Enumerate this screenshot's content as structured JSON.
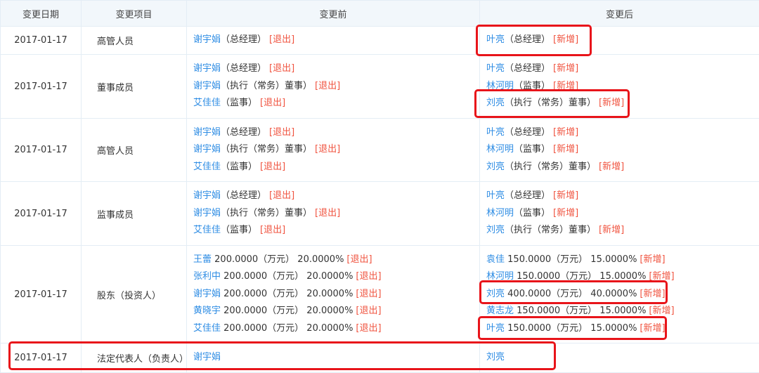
{
  "header": {
    "date": "变更日期",
    "item": "变更项目",
    "before": "变更前",
    "after": "变更后"
  },
  "rows": [
    {
      "date": "2017-01-17",
      "item": "高管人员",
      "before": [
        {
          "name": "谢宇娟",
          "detail": "（总经理）",
          "tag": "[退出]"
        }
      ],
      "after": [
        {
          "name": "叶亮",
          "detail": "（总经理）",
          "tag": "[新增]"
        }
      ]
    },
    {
      "date": "2017-01-17",
      "item": "董事成员",
      "before": [
        {
          "name": "谢宇娟",
          "detail": "（总经理）",
          "tag": "[退出]"
        },
        {
          "name": "谢宇娟",
          "detail": "（执行（常务）董事）",
          "tag": "[退出]"
        },
        {
          "name": "艾佳佳",
          "detail": "（监事）",
          "tag": "[退出]"
        }
      ],
      "after": [
        {
          "name": "叶亮",
          "detail": "（总经理）",
          "tag": "[新增]"
        },
        {
          "name": "林河明",
          "detail": "（监事）",
          "tag": "[新增]"
        },
        {
          "name": "刘亮",
          "detail": "（执行（常务）董事）",
          "tag": "[新增]"
        }
      ]
    },
    {
      "date": "2017-01-17",
      "item": "高管人员",
      "before": [
        {
          "name": "谢宇娟",
          "detail": "（总经理）",
          "tag": "[退出]"
        },
        {
          "name": "谢宇娟",
          "detail": "（执行（常务）董事）",
          "tag": "[退出]"
        },
        {
          "name": "艾佳佳",
          "detail": "（监事）",
          "tag": "[退出]"
        }
      ],
      "after": [
        {
          "name": "叶亮",
          "detail": "（总经理）",
          "tag": "[新增]"
        },
        {
          "name": "林河明",
          "detail": "（监事）",
          "tag": "[新增]"
        },
        {
          "name": "刘亮",
          "detail": "（执行（常务）董事）",
          "tag": "[新增]"
        }
      ]
    },
    {
      "date": "2017-01-17",
      "item": "监事成员",
      "before": [
        {
          "name": "谢宇娟",
          "detail": "（总经理）",
          "tag": "[退出]"
        },
        {
          "name": "谢宇娟",
          "detail": "（执行（常务）董事）",
          "tag": "[退出]"
        },
        {
          "name": "艾佳佳",
          "detail": "（监事）",
          "tag": "[退出]"
        }
      ],
      "after": [
        {
          "name": "叶亮",
          "detail": "（总经理）",
          "tag": "[新增]"
        },
        {
          "name": "林河明",
          "detail": "（监事）",
          "tag": "[新增]"
        },
        {
          "name": "刘亮",
          "detail": "（执行（常务）董事）",
          "tag": "[新增]"
        }
      ]
    },
    {
      "date": "2017-01-17",
      "item": "股东（投资人）",
      "before": [
        {
          "name": "王蕾",
          "detail": " 200.0000（万元） 20.0000%",
          "tag": "[退出]"
        },
        {
          "name": "张利中",
          "detail": " 200.0000（万元） 20.0000%",
          "tag": "[退出]"
        },
        {
          "name": "谢宇娟",
          "detail": " 200.0000（万元） 20.0000%",
          "tag": "[退出]"
        },
        {
          "name": "黄晓宇",
          "detail": " 200.0000（万元） 20.0000%",
          "tag": "[退出]"
        },
        {
          "name": "艾佳佳",
          "detail": " 200.0000（万元） 20.0000%",
          "tag": "[退出]"
        }
      ],
      "after": [
        {
          "name": "袁佳",
          "detail": " 150.0000（万元） 15.0000%",
          "tag": "[新增]"
        },
        {
          "name": "林河明",
          "detail": " 150.0000（万元） 15.0000%",
          "tag": "[新增]"
        },
        {
          "name": "刘亮",
          "detail": " 400.0000（万元） 40.0000%",
          "tag": "[新增]"
        },
        {
          "name": "黄志龙",
          "detail": " 150.0000（万元） 15.0000%",
          "tag": "[新增]"
        },
        {
          "name": "叶亮",
          "detail": " 150.0000（万元） 15.0000%",
          "tag": "[新增]"
        }
      ]
    },
    {
      "date": "2017-01-17",
      "item": "法定代表人（负责人）",
      "before": [
        {
          "name": "谢宇娟",
          "detail": "",
          "tag": ""
        }
      ],
      "after": [
        {
          "name": "刘亮",
          "detail": "",
          "tag": ""
        }
      ]
    }
  ],
  "colors": {
    "link": "#2f8de4",
    "tag": "#f0533f",
    "highlight": "#e8141a"
  }
}
